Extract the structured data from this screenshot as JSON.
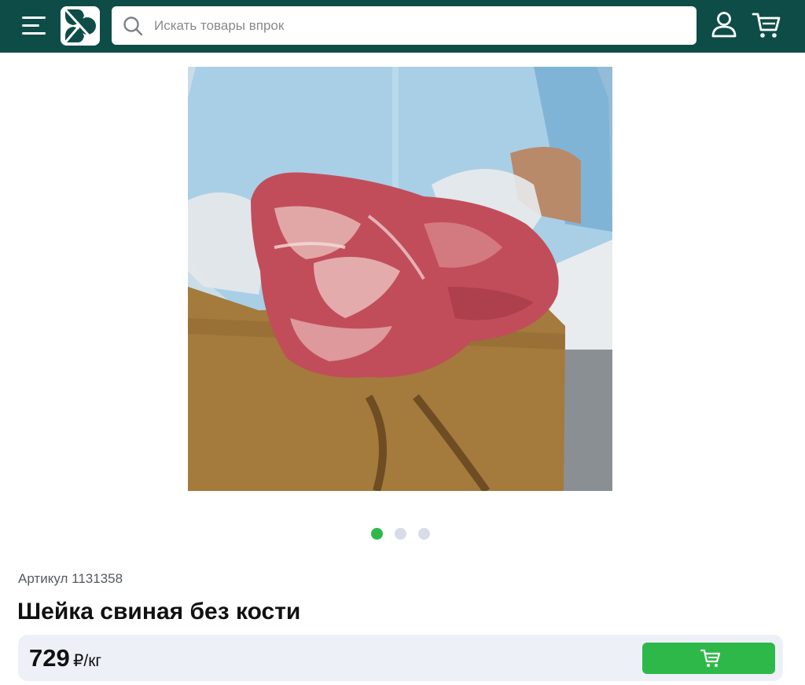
{
  "header": {
    "search": {
      "placeholder": "Искать товары впрок"
    },
    "icons": {
      "menu": "menu-icon",
      "logo": "store-logo",
      "search": "search-icon",
      "profile": "user-icon",
      "cart": "cart-icon"
    },
    "colors": {
      "background": "#0e4d47",
      "icon": "#ffffff"
    }
  },
  "gallery": {
    "image_description_icon": "product-photo",
    "slide_count": 3,
    "active_slide": 1,
    "colors": {
      "active_dot": "#2fb84a",
      "inactive_dot": "#d7dce6"
    }
  },
  "product": {
    "sku_label": "Артикул",
    "sku_value": "1131358",
    "title": "Шейка свиная без кости",
    "price": "729",
    "price_unit": "₽/кг",
    "add_to_cart_icon": "cart-icon"
  },
  "colors": {
    "accent": "#2fb84a",
    "price_bar": "#edf1f7"
  }
}
